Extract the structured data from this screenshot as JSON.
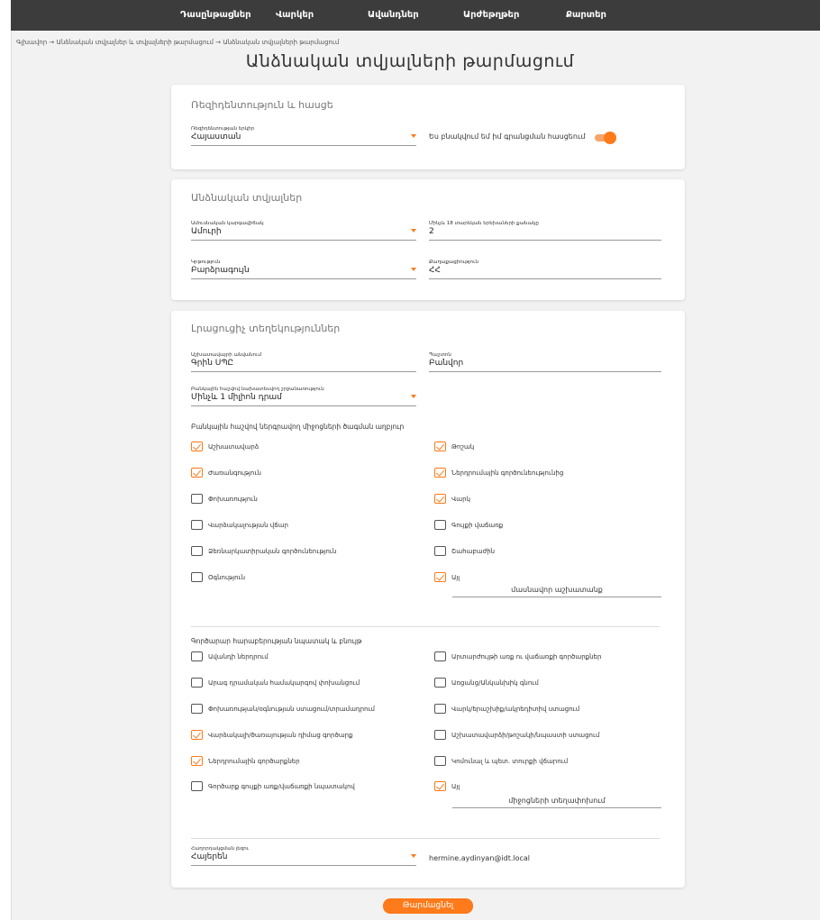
{
  "nav": {
    "items": [
      "Դասընթացներ",
      "Վարկեր",
      "Ավանդներ",
      "Արժեթղթեր",
      "Քարտեր"
    ]
  },
  "breadcrumb": "Գլխավոր → Անձնական տվյալներ և տվյալների թարմացում → Անձնական տվյալների թարմացում",
  "page_title": "Անձնական տվյալների թարմացում",
  "section1": {
    "title": "Ռեզիդենտություն և հասցե",
    "residency_label": "Ռեզիդենտության երկիր",
    "residency_value": "Հայաստան",
    "toggle_label": "Ես բնակվում եմ իմ գրանցման հասցեում",
    "toggle_on": true
  },
  "section2": {
    "title": "Անձնական տվյալներ",
    "marital_label": "Ամուսնական կարգավիճակ",
    "marital_value": "Ամուրի",
    "children_label": "Մինչև 18 տարեկան երեխաների քանակը",
    "children_value": "2",
    "education_label": "Կրթություն",
    "education_value": "Բարձրագույն",
    "citizenship_label": "Քաղաքացիություն",
    "citizenship_value": "ՀՀ"
  },
  "section3": {
    "title": "Լրացուցիչ տեղեկություններ",
    "employer_label": "Աշխատավայրի անվանում",
    "employer_value": "Գրին ՍՊԸ",
    "position_label": "Պաշտոն",
    "position_value": "Բանվոր",
    "income_label": "Բանկային հաշվով նախատեսվող շրջանառություն",
    "income_value": "Մինչև 1 միլիոն դրամ",
    "funds_question": "Բանկային հաշվով ներգրավող միջոցների ծագման աղբյուր",
    "funds": [
      {
        "label": "Աշխատավարձ",
        "checked": true
      },
      {
        "label": "Թոշակ",
        "checked": true
      },
      {
        "label": "Ժառանգություն",
        "checked": true
      },
      {
        "label": "Ներդրումային գործունեությունից",
        "checked": true
      },
      {
        "label": "Փոխառություն",
        "checked": false
      },
      {
        "label": "Վարկ",
        "checked": true
      },
      {
        "label": "Վարձակալության վճար",
        "checked": false
      },
      {
        "label": "Գույքի վաճառք",
        "checked": false
      },
      {
        "label": "Ձեռնարկատիրական գործունեություն",
        "checked": false
      },
      {
        "label": "Շահաբաժին",
        "checked": false
      },
      {
        "label": "Օգնություն",
        "checked": false
      },
      {
        "label": "Այլ",
        "checked": true
      }
    ],
    "funds_other_value": "մասնավոր աշխատանք",
    "purpose_question": "Գործարար հարաբերության նպատակ և բնույթ",
    "purpose": [
      {
        "label": "Ավանդի ներդրում",
        "checked": false
      },
      {
        "label": "Արտարժույթի առք ու վաճառքի գործարքներ",
        "checked": false
      },
      {
        "label": "Արագ դրամական համակարգով փոխանցում",
        "checked": false
      },
      {
        "label": "Առցանց/Անկանխիկ գնում",
        "checked": false
      },
      {
        "label": "Փոխառության/օգնության ստացում/տրամադրում",
        "checked": false
      },
      {
        "label": "Վարկ/երաշխիք/ակրեդիտիվ ստացում",
        "checked": false
      },
      {
        "label": "Վարձակալի/ծառայության դիմաց գործարք",
        "checked": true
      },
      {
        "label": "Աշխատավարձի/թոշակի/նպաստի ստացում",
        "checked": false
      },
      {
        "label": "Ներդրումային գործարքներ",
        "checked": true
      },
      {
        "label": "Կոմունալ և պետ. տուրքի վճարում",
        "checked": false
      },
      {
        "label": "Գործարք գույքի առք/վաճառքի նպատակով",
        "checked": false
      },
      {
        "label": "Այլ",
        "checked": true
      }
    ],
    "purpose_other_value": "միջոցների տեղափոխում",
    "language_label": "Հաղորդակցման լեզու",
    "language_value": "Հայերեն",
    "email": "hermine.aydinyan@idt.local"
  },
  "submit_label": "Թարմացնել",
  "colors": {
    "accent": "#ff7a1a",
    "nav_bg": "#3c3c3c",
    "page_bg": "#f2f2f2"
  }
}
